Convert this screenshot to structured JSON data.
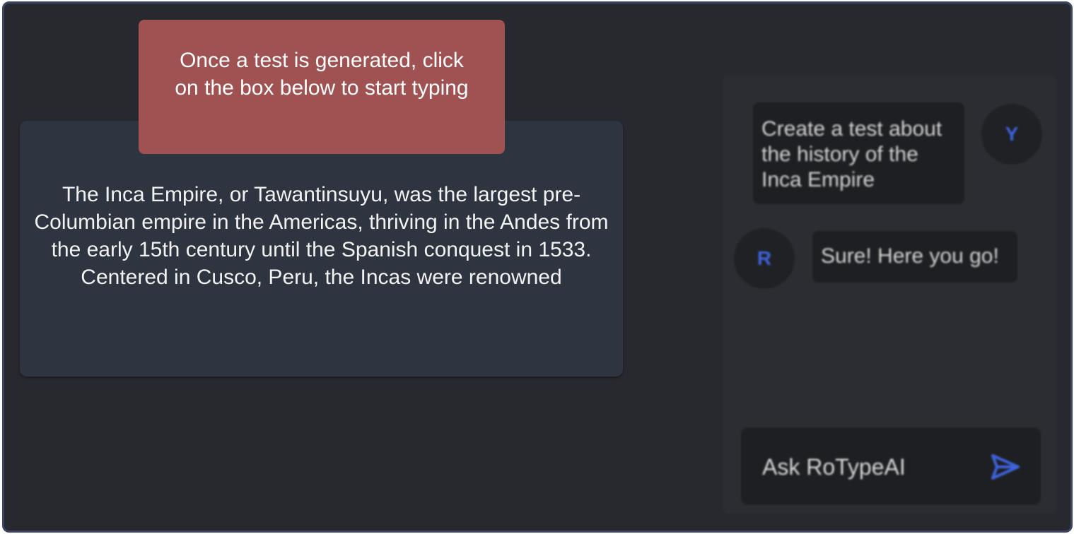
{
  "hint": {
    "text": "Once a test is generated, click on the box below to start typing"
  },
  "typing_box": {
    "text": "The Inca Empire, or Tawantinsuyu, was the largest pre-Columbian empire in the Americas, thriving in the Andes from the  early 15th century until the Spanish conquest in 1533. Centered in  Cusco, Peru, the Incas were renowned"
  },
  "chat": {
    "messages": [
      {
        "sender": "user",
        "avatar": "Y",
        "text": "Create a test about the history of the Inca Empire"
      },
      {
        "sender": "bot",
        "avatar": "R",
        "text": "Sure! Here you go!"
      }
    ],
    "input": {
      "placeholder": "Ask RoTypeAI",
      "send_icon": "send-icon"
    }
  },
  "colors": {
    "background": "#28292e",
    "frame_border": "#3b4560",
    "typing_box": "#2e3440",
    "hint": "#a05252",
    "chat_panel": "#2c2d32",
    "bubble": "#1e1f22",
    "accent": "#3e63dd"
  }
}
